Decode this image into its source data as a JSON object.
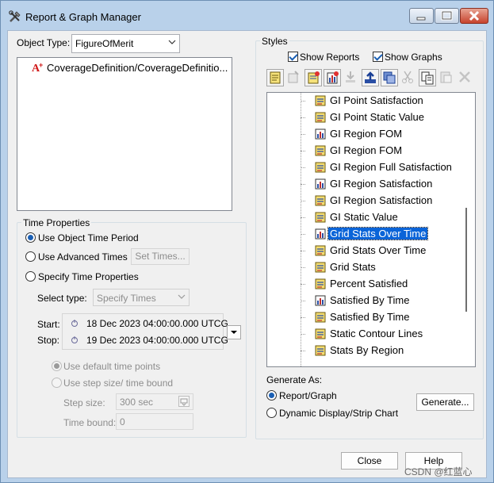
{
  "window": {
    "title": "Report & Graph Manager"
  },
  "object_type": {
    "label": "Object Type:",
    "value": "FigureOfMerit"
  },
  "tree": {
    "item": "CoverageDefinition/CoverageDefinitio..."
  },
  "time_properties": {
    "group_label": "Time Properties",
    "use_object_time": "Use Object Time Period",
    "use_advanced": "Use Advanced Times",
    "set_times_button": "Set Times...",
    "specify_time": "Specify Time Properties",
    "select_type_label": "Select type:",
    "select_type_value": "Specify Times",
    "start_label": "Start:",
    "start_value": "18 Dec 2023 04:00:00.000 UTCG",
    "stop_label": "Stop:",
    "stop_value": "19 Dec 2023 04:00:00.000 UTCG",
    "use_default_points": "Use default time points",
    "use_step_size": "Use step size/ time bound",
    "step_size_label": "Step size:",
    "step_size_value": "300 sec",
    "time_bound_label": "Time bound:",
    "time_bound_value": "0"
  },
  "styles": {
    "group_label": "Styles",
    "show_reports": "Show Reports",
    "show_graphs": "Show Graphs",
    "items": [
      {
        "label": "GI Point Satisfaction",
        "icon": "report-icon"
      },
      {
        "label": "GI Point Static Value",
        "icon": "report-icon"
      },
      {
        "label": "GI Region FOM",
        "icon": "graph-icon"
      },
      {
        "label": "GI Region FOM",
        "icon": "report-icon"
      },
      {
        "label": "GI Region Full Satisfaction",
        "icon": "report-icon"
      },
      {
        "label": "GI Region Satisfaction",
        "icon": "graph-icon"
      },
      {
        "label": "GI Region Satisfaction",
        "icon": "report-icon"
      },
      {
        "label": "GI Static Value",
        "icon": "report-icon"
      },
      {
        "label": "Grid Stats Over Time",
        "icon": "graph-icon"
      },
      {
        "label": "Grid Stats Over Time",
        "icon": "report-icon"
      },
      {
        "label": "Grid Stats",
        "icon": "report-icon"
      },
      {
        "label": "Percent Satisfied",
        "icon": "report-icon"
      },
      {
        "label": "Satisfied By Time",
        "icon": "graph-icon"
      },
      {
        "label": "Satisfied By Time",
        "icon": "report-icon"
      },
      {
        "label": "Static Contour Lines",
        "icon": "report-icon"
      },
      {
        "label": "Stats By Region",
        "icon": "report-icon"
      }
    ]
  },
  "generate": {
    "label": "Generate As:",
    "report_graph": "Report/Graph",
    "dynamic_display": "Dynamic Display/Strip Chart",
    "generate_button": "Generate..."
  },
  "footer": {
    "close_button": "Close",
    "help_button": "Help"
  },
  "watermark": "CSDN @红蓝心"
}
